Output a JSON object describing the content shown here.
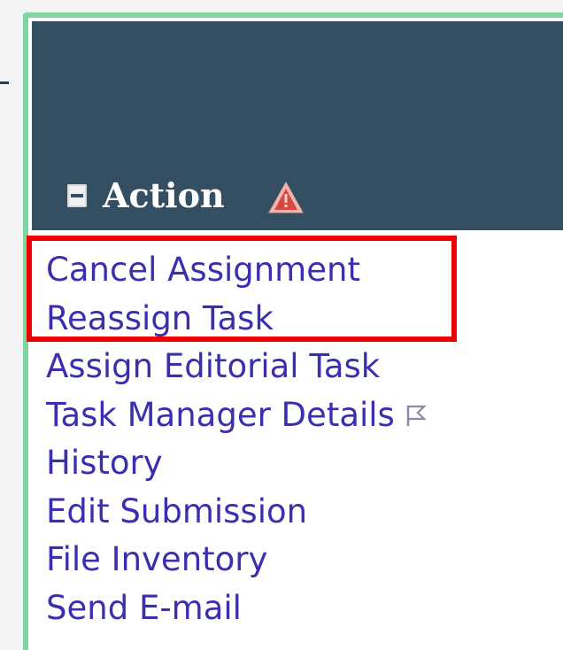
{
  "header": {
    "title": "Action",
    "collapse_icon": "collapse-minus-icon",
    "warning_icon": "warning-triangle-icon"
  },
  "actions": [
    {
      "label": "Cancel Assignment"
    },
    {
      "label": "Reassign Task"
    },
    {
      "label": "Assign Editorial Task"
    },
    {
      "label": "Task Manager Details",
      "icon": "flag-icon"
    },
    {
      "label": "History"
    },
    {
      "label": "Edit Submission"
    },
    {
      "label": "File Inventory"
    },
    {
      "label": "Send E-mail"
    }
  ],
  "colors": {
    "header_bg": "#344f62",
    "link": "#3b2fb0",
    "frame_border": "#7fd6a0",
    "highlight": "#ee0000"
  }
}
